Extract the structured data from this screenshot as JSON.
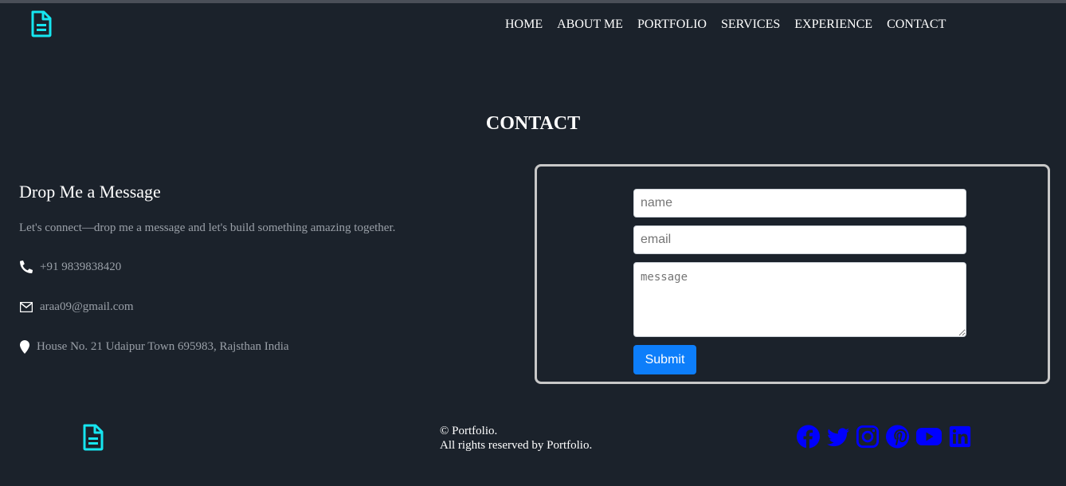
{
  "header": {
    "nav": [
      "HOME",
      "ABOUT ME",
      "PORTFOLIO",
      "SERVICES",
      "EXPERIENCE",
      "CONTACT"
    ]
  },
  "contact": {
    "title": "CONTACT",
    "heading": "Drop Me a Message",
    "intro": "Let's connect—drop me a message and let's build something amazing together.",
    "phone": "+91 9839838420",
    "email": "araa09@gmail.com",
    "address": "House No. 21 Udaipur Town 695983, Rajsthan India"
  },
  "form": {
    "name_placeholder": "name",
    "email_placeholder": "email",
    "message_placeholder": "message",
    "submit_label": "Submit"
  },
  "footer": {
    "copyright_line1": "© Portfolio.",
    "copyright_line2": "All rights reserved by Portfolio."
  },
  "icons": {
    "logo": "file-text-icon",
    "phone": "phone-icon",
    "email": "envelope-icon",
    "address": "map-marker-icon",
    "socials": [
      "facebook-icon",
      "twitter-icon",
      "instagram-icon",
      "pinterest-icon",
      "youtube-icon",
      "linkedin-icon"
    ]
  },
  "colors": {
    "background": "#1b222b",
    "logo_accent": "#16e6f0",
    "social_icons": "#0000ff",
    "submit_button": "#0d7efa",
    "muted_text": "#9aa0a8"
  }
}
